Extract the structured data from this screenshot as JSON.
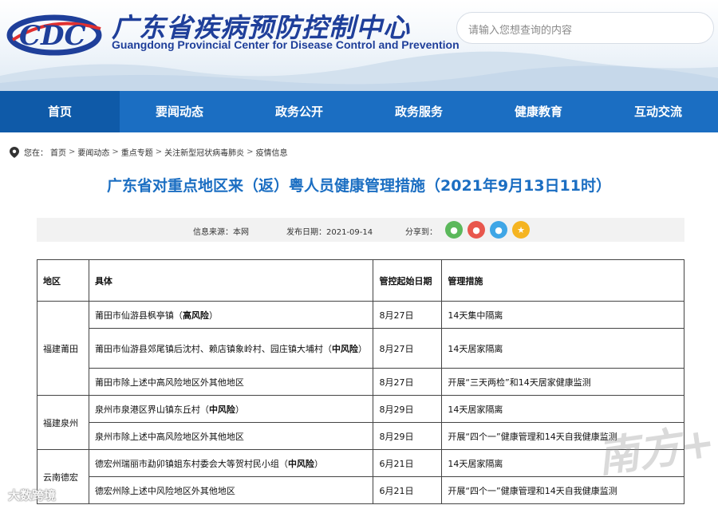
{
  "header": {
    "logo_text": "CDC",
    "title_cn": "广东省疾病预防控制中心",
    "title_en": "Guangdong Provincial Center for Disease Control and Prevention",
    "search_placeholder": "请输入您想查询的内容"
  },
  "nav": {
    "items": [
      {
        "label": "首页",
        "active": true
      },
      {
        "label": "要闻动态"
      },
      {
        "label": "政务公开"
      },
      {
        "label": "政务服务"
      },
      {
        "label": "健康教育"
      },
      {
        "label": "互动交流"
      }
    ]
  },
  "breadcrumb": {
    "prefix": "您在：",
    "items": [
      "首页",
      "要闻动态",
      "重点专题",
      "关注新型冠状病毒肺炎",
      "疫情信息"
    ],
    "separator": ">"
  },
  "article": {
    "title": "广东省对重点地区来（返）粤人员健康管理措施（2021年9月13日11时）",
    "source_label": "信息来源：本网",
    "date_label": "发布日期：2021-09-14",
    "share_label": "分享到："
  },
  "share_icons": [
    {
      "name": "wechat-icon",
      "color": "#5bb85b",
      "glyph": "●"
    },
    {
      "name": "weibo-icon",
      "color": "#e8574d",
      "glyph": "●"
    },
    {
      "name": "qq-icon",
      "color": "#3fa6e6",
      "glyph": "●"
    },
    {
      "name": "qzone-icon",
      "color": "#f5b421",
      "glyph": "★"
    }
  ],
  "table": {
    "headers": [
      "地区",
      "具体",
      "管控起始日期",
      "管理措施"
    ],
    "groups": [
      {
        "region": "福建莆田",
        "rows": [
          {
            "detail": "莆田市仙游县枫亭镇（",
            "bold": "高风险",
            "tail": "）",
            "date": "8月27日",
            "measure": "14天集中隔离",
            "tall": false
          },
          {
            "detail": "莆田市仙游县郊尾镇后沈村、赖店镇象岭村、园庄镇大埔村（",
            "bold": "中风险",
            "tail": "）",
            "date": "8月27日",
            "measure": "14天居家隔离",
            "tall": true
          },
          {
            "detail": "莆田市除上述中高风险地区外其他地区",
            "bold": "",
            "tail": "",
            "date": "8月27日",
            "measure": "开展“三天两检”和14天居家健康监测",
            "tall": false
          }
        ]
      },
      {
        "region": "福建泉州",
        "rows": [
          {
            "detail": "泉州市泉港区界山镇东丘村（",
            "bold": "中风险",
            "tail": "）",
            "date": "8月29日",
            "measure": "14天居家隔离",
            "tall": false
          },
          {
            "detail": "泉州市除上述中高风险地区外其他地区",
            "bold": "",
            "tail": "",
            "date": "8月29日",
            "measure": "开展“四个一”健康管理和14天自我健康监测",
            "tall": false
          }
        ]
      },
      {
        "region": "云南德宏",
        "rows": [
          {
            "detail": "德宏州瑞丽市勐卯镇姐东村委会大等贺村民小组（",
            "bold": "中风险",
            "tail": "）",
            "date": "6月21日",
            "measure": "14天居家隔离",
            "tall": false
          },
          {
            "detail": "德宏州除上述中风险地区外其他地区",
            "bold": "",
            "tail": "",
            "date": "6月21日",
            "measure": "开展“四个一”健康管理和14天自我健康监测",
            "tall": false
          }
        ]
      }
    ]
  },
  "watermarks": {
    "right": "南方+",
    "left": "大数跨境"
  }
}
